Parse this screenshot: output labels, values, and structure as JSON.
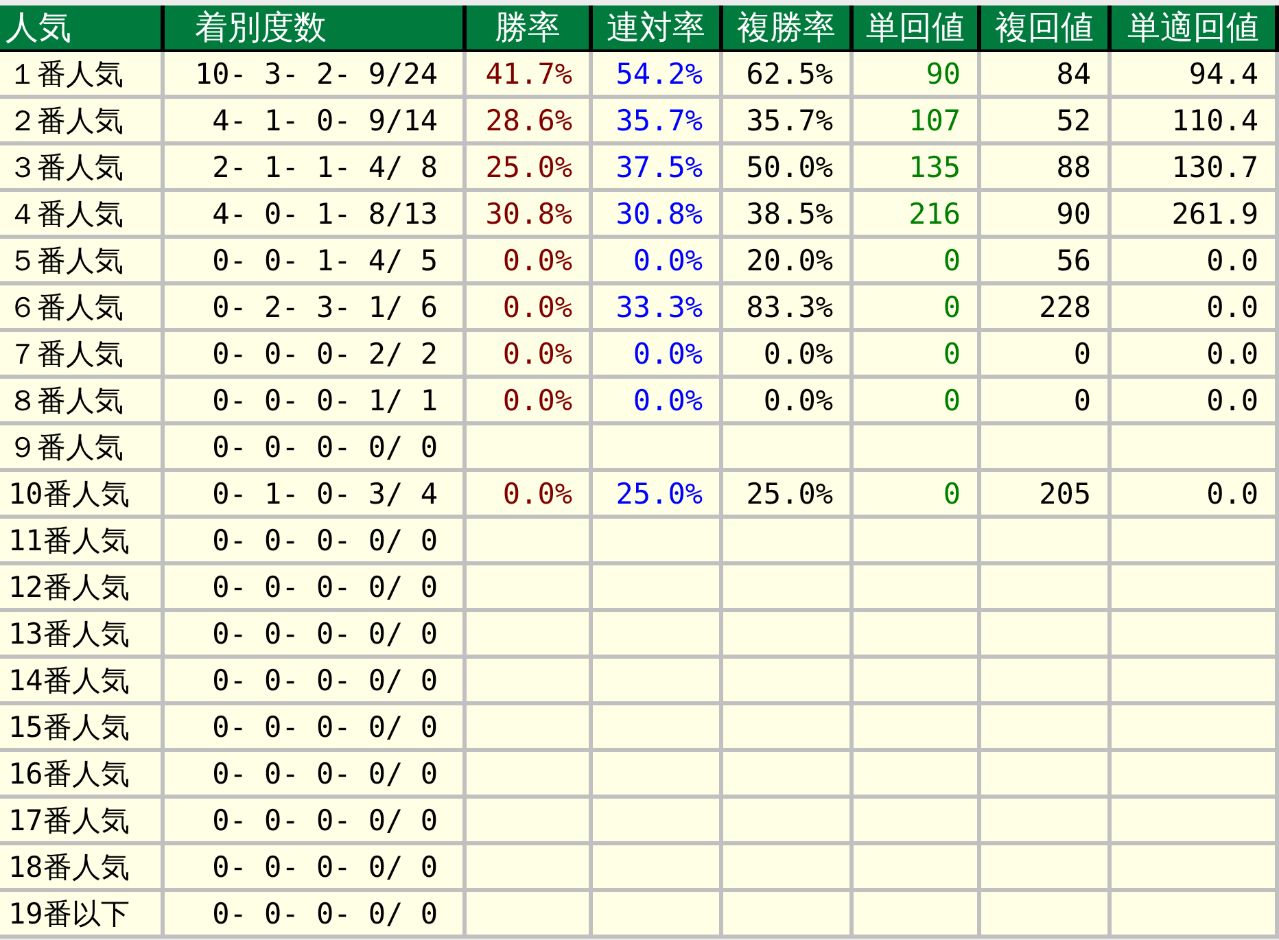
{
  "table": {
    "columns": [
      {
        "label": "人気",
        "color": "#000000"
      },
      {
        "label": "着別度数",
        "color": "#000000"
      },
      {
        "label": "勝率",
        "color": "#800000"
      },
      {
        "label": "連対率",
        "color": "#0000ff"
      },
      {
        "label": "複勝率",
        "color": "#000000"
      },
      {
        "label": "単回値",
        "color": "#008000"
      },
      {
        "label": "複回値",
        "color": "#000000"
      },
      {
        "label": "単適回値",
        "color": "#000000"
      }
    ],
    "rows": [
      {
        "cells": [
          "１番人気",
          "10- 3- 2- 9/24",
          "41.7%",
          "54.2%",
          "62.5%",
          "90",
          "84",
          "94.4"
        ]
      },
      {
        "cells": [
          "２番人気",
          "4- 1- 0- 9/14",
          "28.6%",
          "35.7%",
          "35.7%",
          "107",
          "52",
          "110.4"
        ]
      },
      {
        "cells": [
          "３番人気",
          "2- 1- 1- 4/ 8",
          "25.0%",
          "37.5%",
          "50.0%",
          "135",
          "88",
          "130.7"
        ]
      },
      {
        "cells": [
          "４番人気",
          "4- 0- 1- 8/13",
          "30.8%",
          "30.8%",
          "38.5%",
          "216",
          "90",
          "261.9"
        ]
      },
      {
        "cells": [
          "５番人気",
          "0- 0- 1- 4/ 5",
          "0.0%",
          "0.0%",
          "20.0%",
          "0",
          "56",
          "0.0"
        ]
      },
      {
        "cells": [
          "６番人気",
          "0- 2- 3- 1/ 6",
          "0.0%",
          "33.3%",
          "83.3%",
          "0",
          "228",
          "0.0"
        ]
      },
      {
        "cells": [
          "７番人気",
          "0- 0- 0- 2/ 2",
          "0.0%",
          "0.0%",
          "0.0%",
          "0",
          "0",
          "0.0"
        ]
      },
      {
        "cells": [
          "８番人気",
          "0- 0- 0- 1/ 1",
          "0.0%",
          "0.0%",
          "0.0%",
          "0",
          "0",
          "0.0"
        ]
      },
      {
        "cells": [
          "９番人気",
          "0- 0- 0- 0/ 0"
        ]
      },
      {
        "cells": [
          "10番人気",
          "0- 1- 0- 3/ 4",
          "0.0%",
          "25.0%",
          "25.0%",
          "0",
          "205",
          "0.0"
        ]
      },
      {
        "cells": [
          "11番人気",
          "0- 0- 0- 0/ 0"
        ]
      },
      {
        "cells": [
          "12番人気",
          "0- 0- 0- 0/ 0"
        ]
      },
      {
        "cells": [
          "13番人気",
          "0- 0- 0- 0/ 0"
        ]
      },
      {
        "cells": [
          "14番人気",
          "0- 0- 0- 0/ 0"
        ]
      },
      {
        "cells": [
          "15番人気",
          "0- 0- 0- 0/ 0"
        ]
      },
      {
        "cells": [
          "16番人気",
          "0- 0- 0- 0/ 0"
        ]
      },
      {
        "cells": [
          "17番人気",
          "0- 0- 0- 0/ 0"
        ]
      },
      {
        "cells": [
          "18番人気",
          "0- 0- 0- 0/ 0"
        ]
      },
      {
        "cells": [
          "19番以下",
          "0- 0- 0- 0/ 0"
        ]
      }
    ]
  }
}
